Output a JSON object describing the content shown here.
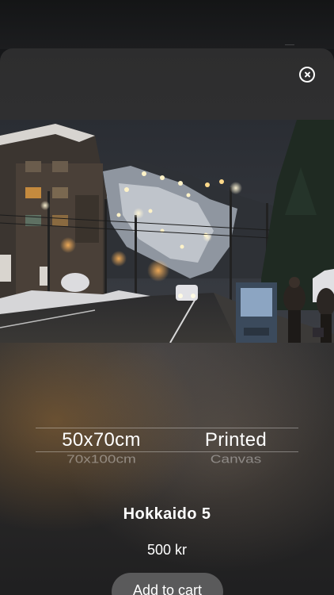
{
  "product": {
    "title": "Hokkaido 5",
    "price": "500 kr",
    "image_alt": "Night street in Hokkaido ski town with illuminated ski slope"
  },
  "picker": {
    "size": {
      "selected": "50x70cm",
      "next": "70x100cm"
    },
    "finish": {
      "selected": "Printed",
      "next": "Canvas"
    }
  },
  "actions": {
    "add_to_cart_label": "Add to cart"
  },
  "icons": {
    "close": "close-circle-icon"
  },
  "colors": {
    "sheet": "#303030",
    "button": "#5a5a5b",
    "text": "#ffffff"
  }
}
